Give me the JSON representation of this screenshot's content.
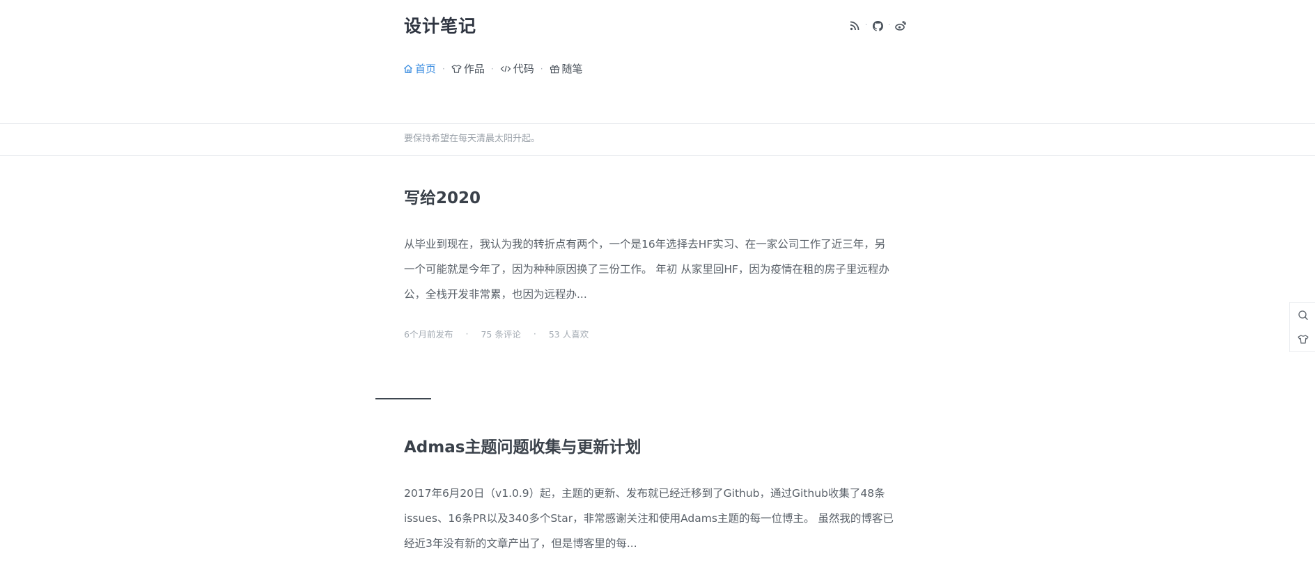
{
  "site": {
    "title": "设计笔记",
    "motto": "要保持希望在每天清晨太阳升起。"
  },
  "social": [
    {
      "icon": "rss-icon"
    },
    {
      "icon": "github-icon"
    },
    {
      "icon": "weibo-icon"
    }
  ],
  "nav": {
    "items": [
      {
        "label": "首页",
        "icon": "home-icon",
        "active": true
      },
      {
        "label": "作品",
        "icon": "shirt-icon",
        "active": false
      },
      {
        "label": "代码",
        "icon": "code-icon",
        "active": false
      },
      {
        "label": "随笔",
        "icon": "gift-icon",
        "active": false
      }
    ]
  },
  "posts": [
    {
      "title": "写给2020",
      "excerpt": "从毕业到现在，我认为我的转折点有两个，一个是16年选择去HF实习、在一家公司工作了近三年，另一个可能就是今年了，因为种种原因换了三份工作。 年初 从家里回HF，因为疫情在租的房子里远程办公，全栈开发非常累，也因为远程办...",
      "published": "6个月前发布",
      "comments": "75 条评论",
      "likes": "53 人喜欢"
    },
    {
      "title": "Admas主题问题收集与更新计划",
      "excerpt": "2017年6月20日（v1.0.9）起，主题的更新、发布就已经迁移到了Github，通过Github收集了48条issues、16条PR以及340多个Star，非常感谢关注和使用Adams主题的每一位博主。 虽然我的博客已经近3年没有新的文章产出了，但是博客里的每..."
    }
  ],
  "side_tools": [
    {
      "icon": "search-icon"
    },
    {
      "icon": "shirt-icon"
    }
  ],
  "colors": {
    "accent": "#3b8de0",
    "text": "#3f4750",
    "muted": "#a5acb4",
    "border": "#eceef1"
  }
}
